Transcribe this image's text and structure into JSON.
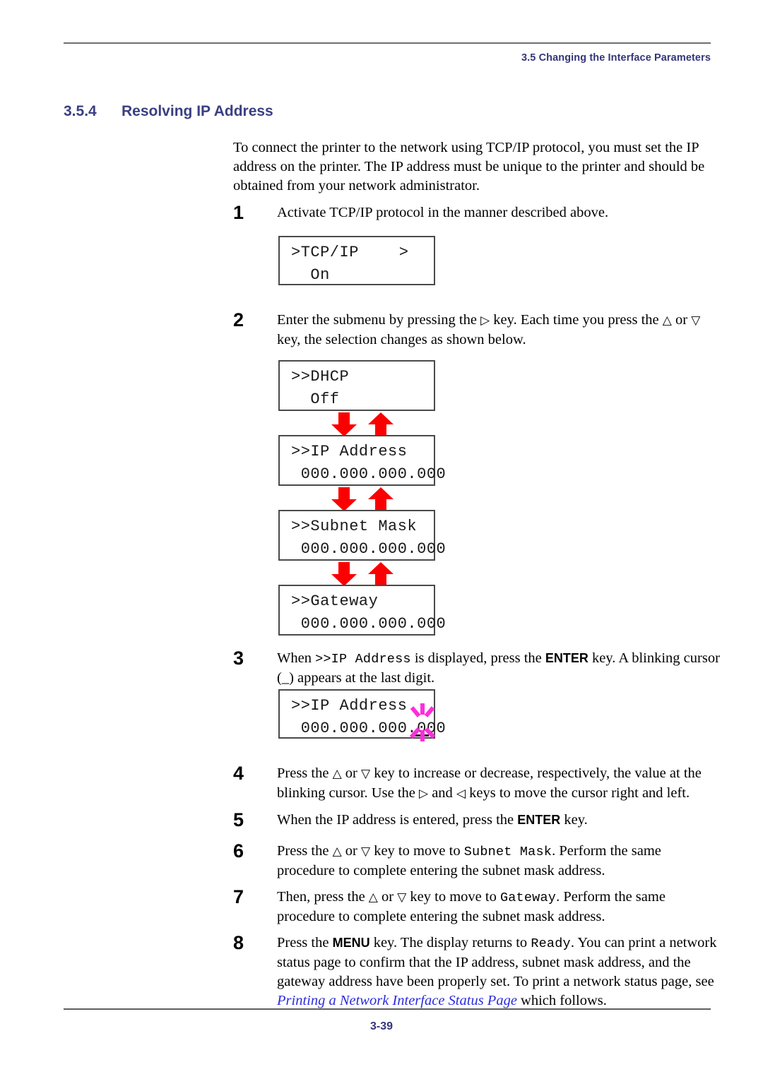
{
  "header": {
    "running_head": "3.5 Changing the Interface Parameters"
  },
  "section": {
    "number": "3.5.4",
    "title": "Resolving IP Address"
  },
  "intro": "To connect the printer to the network using TCP/IP protocol, you must set the IP address on the printer. The IP address must be unique to the printer and should be obtained from your network administrator.",
  "steps": {
    "s1": {
      "number": "1",
      "text": "Activate TCP/IP protocol in the manner described above."
    },
    "s2": {
      "number": "2",
      "text_a": "Enter the submenu by pressing the ",
      "key_right": "▷",
      "text_b": " key. Each time you press the ",
      "key_up": "△",
      "text_c": " or ",
      "key_down": "▽",
      "text_d": " key, the selection changes as shown below."
    },
    "s3": {
      "number": "3",
      "text_a": "When ",
      "mono_a": ">>IP Address",
      "text_b": " is displayed, press the ",
      "key_enter": "ENTER",
      "text_c": " key. A blinking cursor (_) appears at the last digit."
    },
    "s4": {
      "number": "4",
      "text_a": "Press the ",
      "key_up": "△",
      "text_b": " or ",
      "key_down": "▽",
      "text_c": " key to increase or decrease, respectively, the value at the blinking cursor. Use the ",
      "key_right": "▷",
      "text_d": " and ",
      "key_left": "◁",
      "text_e": " keys to move the cursor right and left."
    },
    "s5": {
      "number": "5",
      "text_a": "When the IP address is entered, press the ",
      "key_enter": "ENTER",
      "text_b": " key."
    },
    "s6": {
      "number": "6",
      "text_a": "Press the ",
      "key_up": "△",
      "text_b": " or ",
      "key_down": "▽",
      "text_c": " key to move to ",
      "mono_a": "Subnet Mask",
      "text_d": ". Perform the same procedure to complete entering the subnet mask address."
    },
    "s7": {
      "number": "7",
      "text_a": "Then, press the ",
      "key_up": "△",
      "text_b": " or ",
      "key_down": "▽",
      "text_c": " key to move to ",
      "mono_a": "Gateway",
      "text_d": ". Perform the same procedure to complete entering the subnet mask address."
    },
    "s8": {
      "number": "8",
      "text_a": "Press the ",
      "key_menu": "MENU",
      "text_b": " key. The display returns to ",
      "mono_a": "Ready",
      "text_c": ". You can print a network status page to confirm that the IP address, subnet mask address, and the gateway address have been properly set. To print a network status page, see ",
      "xref": "Printing a Network Interface Status Page",
      "text_d": " which follows."
    }
  },
  "lcd_panels": {
    "tcpip": {
      "line1": ">TCP/IP",
      "right_mark": ">",
      "line2": "  On"
    },
    "dhcp": {
      "line1": ">>DHCP",
      "line2": "  Off"
    },
    "ip_address": {
      "line1": ">>IP Address",
      "line2": " 000.000.000.000"
    },
    "subnet_mask": {
      "line1": ">>Subnet Mask",
      "line2": " 000.000.000.000"
    },
    "gateway": {
      "line1": ">>Gateway",
      "line2": " 000.000.000.000"
    },
    "ip_address_cursor": {
      "line1": ">>IP Address",
      "line2": " 000.000.000.000"
    }
  },
  "colors": {
    "heading": "#3a3f82",
    "arrow_red": "#fb0000",
    "sparkle_magenta": "#ff2ddd",
    "xref_blue": "#2b2bdd",
    "rule_gray": "#6f6f6f"
  },
  "footer": {
    "page_number": "3-39"
  }
}
